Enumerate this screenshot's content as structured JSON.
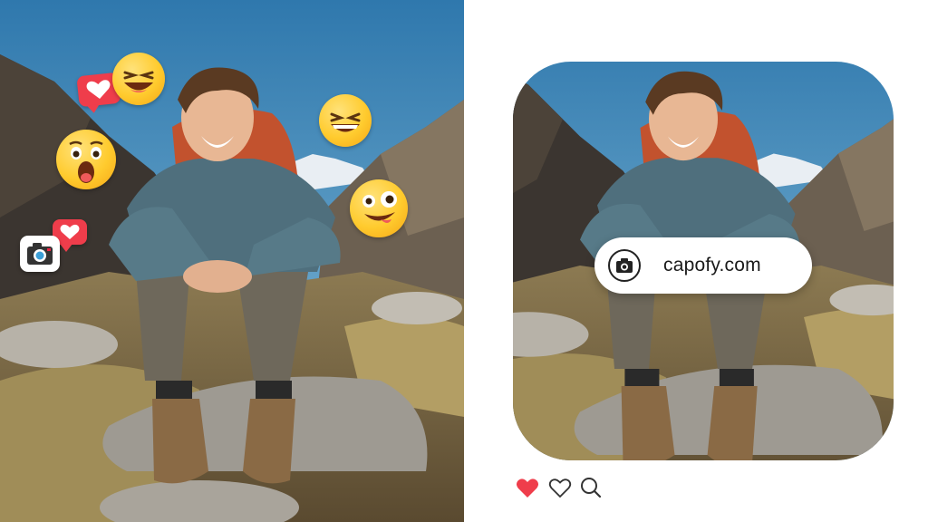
{
  "url_pill": {
    "text": "capofy.com",
    "icon": "camera-icon"
  },
  "left_photo": {
    "overlay_icons": [
      "heart-reaction-icon",
      "laughing-emoji-icon",
      "grinning-squint-emoji-icon",
      "surprised-emoji-icon",
      "heart-reaction-icon",
      "zany-emoji-icon",
      "camera-icon"
    ]
  },
  "action_bar": {
    "icons": [
      "heart-filled-icon",
      "heart-outline-icon",
      "search-icon"
    ],
    "liked": true
  },
  "colors": {
    "like": "#ef3d4b",
    "emoji": "#ffcb2e",
    "sky": "#4f93bf"
  }
}
